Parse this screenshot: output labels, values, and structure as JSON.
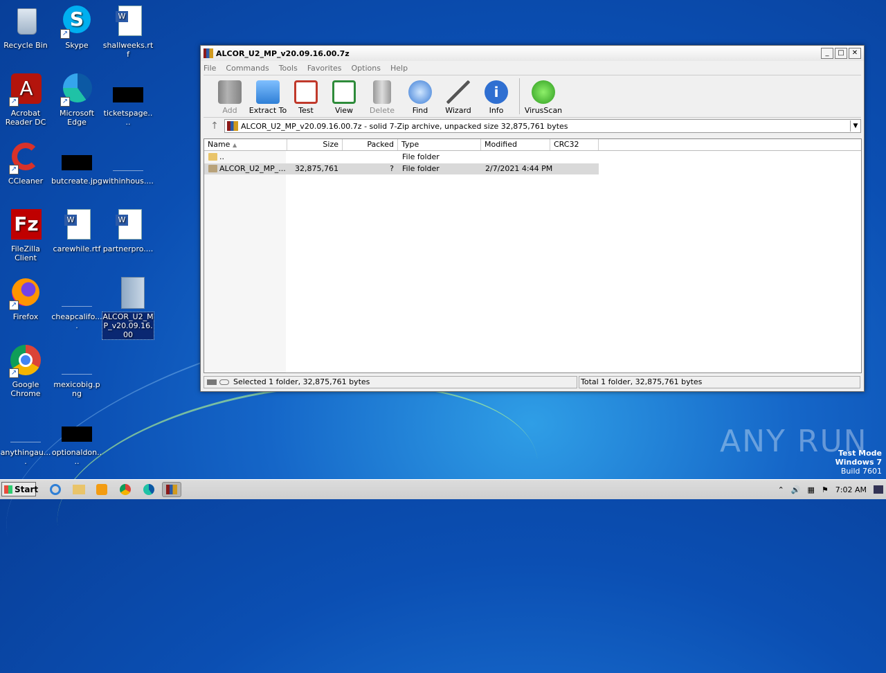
{
  "desktop": {
    "icons": [
      {
        "label": "Recycle Bin"
      },
      {
        "label": "Skype"
      },
      {
        "label": "shallweeks.rtf"
      },
      {
        "label": "Acrobat Reader DC"
      },
      {
        "label": "Microsoft Edge"
      },
      {
        "label": "ticketspage...."
      },
      {
        "label": "CCleaner"
      },
      {
        "label": "butcreate.jpg"
      },
      {
        "label": "withinhous...."
      },
      {
        "label": "FileZilla Client"
      },
      {
        "label": "carewhile.rtf"
      },
      {
        "label": "partnerpro...."
      },
      {
        "label": "Firefox"
      },
      {
        "label": "cheapcalifo...."
      },
      {
        "label": "ALCOR_U2_MP_v20.09.16.00"
      },
      {
        "label": "Google Chrome"
      },
      {
        "label": "mexicobig.png"
      },
      {
        "label": "anythingau...."
      },
      {
        "label": "optionaldon...."
      }
    ]
  },
  "window": {
    "title": "ALCOR_U2_MP_v20.09.16.00.7z",
    "menu": [
      "File",
      "Commands",
      "Tools",
      "Favorites",
      "Options",
      "Help"
    ],
    "toolbar": [
      {
        "label": "Add",
        "icon": "add-icon"
      },
      {
        "label": "Extract To",
        "icon": "extract-icon"
      },
      {
        "label": "Test",
        "icon": "test-icon"
      },
      {
        "label": "View",
        "icon": "view-icon"
      },
      {
        "label": "Delete",
        "icon": "delete-icon"
      },
      {
        "label": "Find",
        "icon": "find-icon"
      },
      {
        "label": "Wizard",
        "icon": "wizard-icon"
      },
      {
        "label": "Info",
        "icon": "info-icon"
      },
      {
        "label": "VirusScan",
        "icon": "virusscan-icon"
      }
    ],
    "address": "ALCOR_U2_MP_v20.09.16.00.7z - solid 7-Zip archive, unpacked size 32,875,761 bytes",
    "columns": [
      "Name",
      "Size",
      "Packed",
      "Type",
      "Modified",
      "CRC32"
    ],
    "rows": [
      {
        "name": "..",
        "size": "",
        "packed": "",
        "type": "File folder",
        "modified": ""
      },
      {
        "name": "ALCOR_U2_MP_...",
        "size": "32,875,761",
        "packed": "?",
        "type": "File folder",
        "modified": "2/7/2021 4:44 PM"
      }
    ],
    "status_left": "Selected 1 folder, 32,875,761 bytes",
    "status_right": "Total 1 folder, 32,875,761 bytes"
  },
  "watermark": {
    "brand": "ANY RUN",
    "line1": "Test Mode",
    "line2": "Windows 7",
    "line3": "Build 7601"
  },
  "taskbar": {
    "start_label": "Start",
    "clock": "7:02 AM"
  }
}
